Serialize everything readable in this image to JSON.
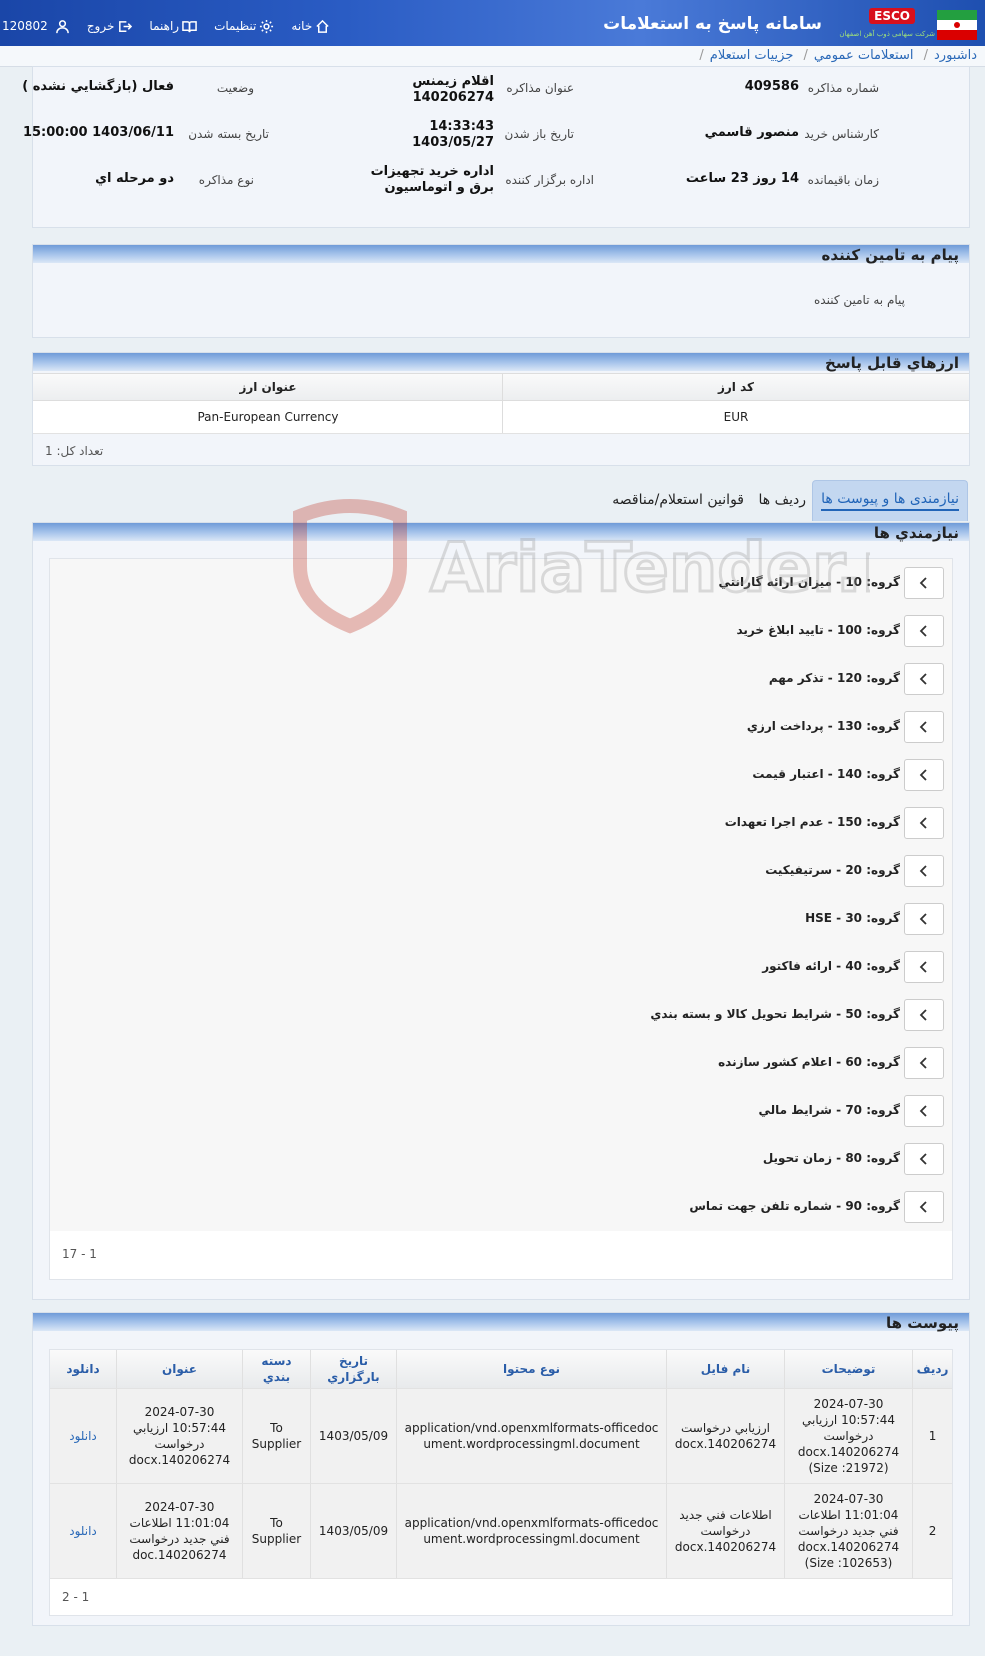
{
  "header": {
    "app_title": "سامانه پاسخ به استعلامات",
    "logo_badge": "ESCO",
    "logo_sub": "شرکت سهامی ذوب آهن اصفهان",
    "user_id": "120802",
    "menu": {
      "logout": "خروج",
      "help": "راهنما",
      "settings": "تنظیمات",
      "home": "خانه"
    }
  },
  "breadcrumb": [
    "داشبورد",
    "استعلامات عمومي",
    "جزييات استعلام"
  ],
  "info": {
    "negotiation_no_label": "شماره مذاکره",
    "negotiation_no": "409586",
    "title_label": "عنوان مذاکره",
    "title": "اقلام زيمنس 140206274",
    "status_label": "وضعيت",
    "status": "فعال (بازگشايي نشده )",
    "buyer_label": "كارشناس خريد",
    "buyer": "منصور قاسمي",
    "open_date_label": "تاريخ باز شدن",
    "open_date": "14:33:43 1403/05/27",
    "close_date_label": "تاريخ بسته شدن",
    "close_date": "1403/06/11 15:00:00",
    "remaining_label": "زمان باقيمانده",
    "remaining": "14 روز 23 ساعت",
    "org_label": "اداره برگزار كننده",
    "org": "اداره خريد تجهيزات برق و اتوماسيون",
    "type_label": "نوع مذاکره",
    "type": "دو مرحله اي"
  },
  "message": {
    "title": "پیام به تامین کننده",
    "label": "پیام به تامین کننده"
  },
  "currencies": {
    "title": "ارزهاي قابل پاسخ",
    "col_code": "كد ارز",
    "col_name": "عنوان ارز",
    "rows": [
      {
        "code": "EUR",
        "name": "Pan-European Currency"
      }
    ],
    "count": "تعداد کل: 1"
  },
  "tabs": [
    "نیازمندی ها و پیوست ها",
    "رديف ها",
    "قوانين استعلام/مناقصه"
  ],
  "requirements": {
    "title": "نیازمندي ها",
    "groups": [
      "گروه: 10 - ميزان ارائه گارانتي",
      "گروه: 100 - تاييد ابلاغ خريد",
      "گروه: 120 - تذکر مهم",
      "گروه: 130 - پرداخت ارزي",
      "گروه: 140 - اعتبار قيمت",
      "گروه: 150 - عدم اجرا تعهدات",
      "گروه: 20 - سرتيفيکيت",
      "گروه: 30 - HSE",
      "گروه: 40 - ارائه فاکتور",
      "گروه: 50 - شرايط تحويل کالا و بسته بندي",
      "گروه: 60 - اعلام کشور سازنده",
      "گروه: 70 - شرايط مالي",
      "گروه: 80 - زمان تحويل",
      "گروه: 90 - شماره تلفن جهت تماس"
    ],
    "count": "1 - 17"
  },
  "attachments": {
    "title": "پيوست ها",
    "headers": [
      "رديف",
      "توضيحات",
      "نام فايل",
      "نوع محتوا",
      "تاريخ بارگزاري",
      "دسته بندي",
      "عنوان",
      "دانلود"
    ],
    "rows": [
      {
        "row": "1",
        "desc": "2024-07-30 10:57:44 ارزيابي درخواست docx.140206274 (Size :21972)",
        "file": "ارزيابي درخواست docx.140206274",
        "mime": "application/vnd.openxmlformats-officedocument.wordprocessingml.document",
        "date": "1403/05/09",
        "category": "To Supplier",
        "title": "2024-07-30 10:57:44 ارزيابي درخواست docx.140206274",
        "download": "دانلود"
      },
      {
        "row": "2",
        "desc": "2024-07-30 11:01:04 اطلاعات فني جديد درخواست docx.140206274 (Size :102653)",
        "file": "اطلاعات فني جديد درخواست docx.140206274",
        "mime": "application/vnd.openxmlformats-officedocument.wordprocessingml.document",
        "date": "1403/05/09",
        "category": "To Supplier",
        "title": "2024-07-30 11:01:04 اطلاعات فني جديد درخواست doc.140206274",
        "download": "دانلود"
      }
    ],
    "count": "1 - 2"
  },
  "watermark": "AriaTender.neT"
}
